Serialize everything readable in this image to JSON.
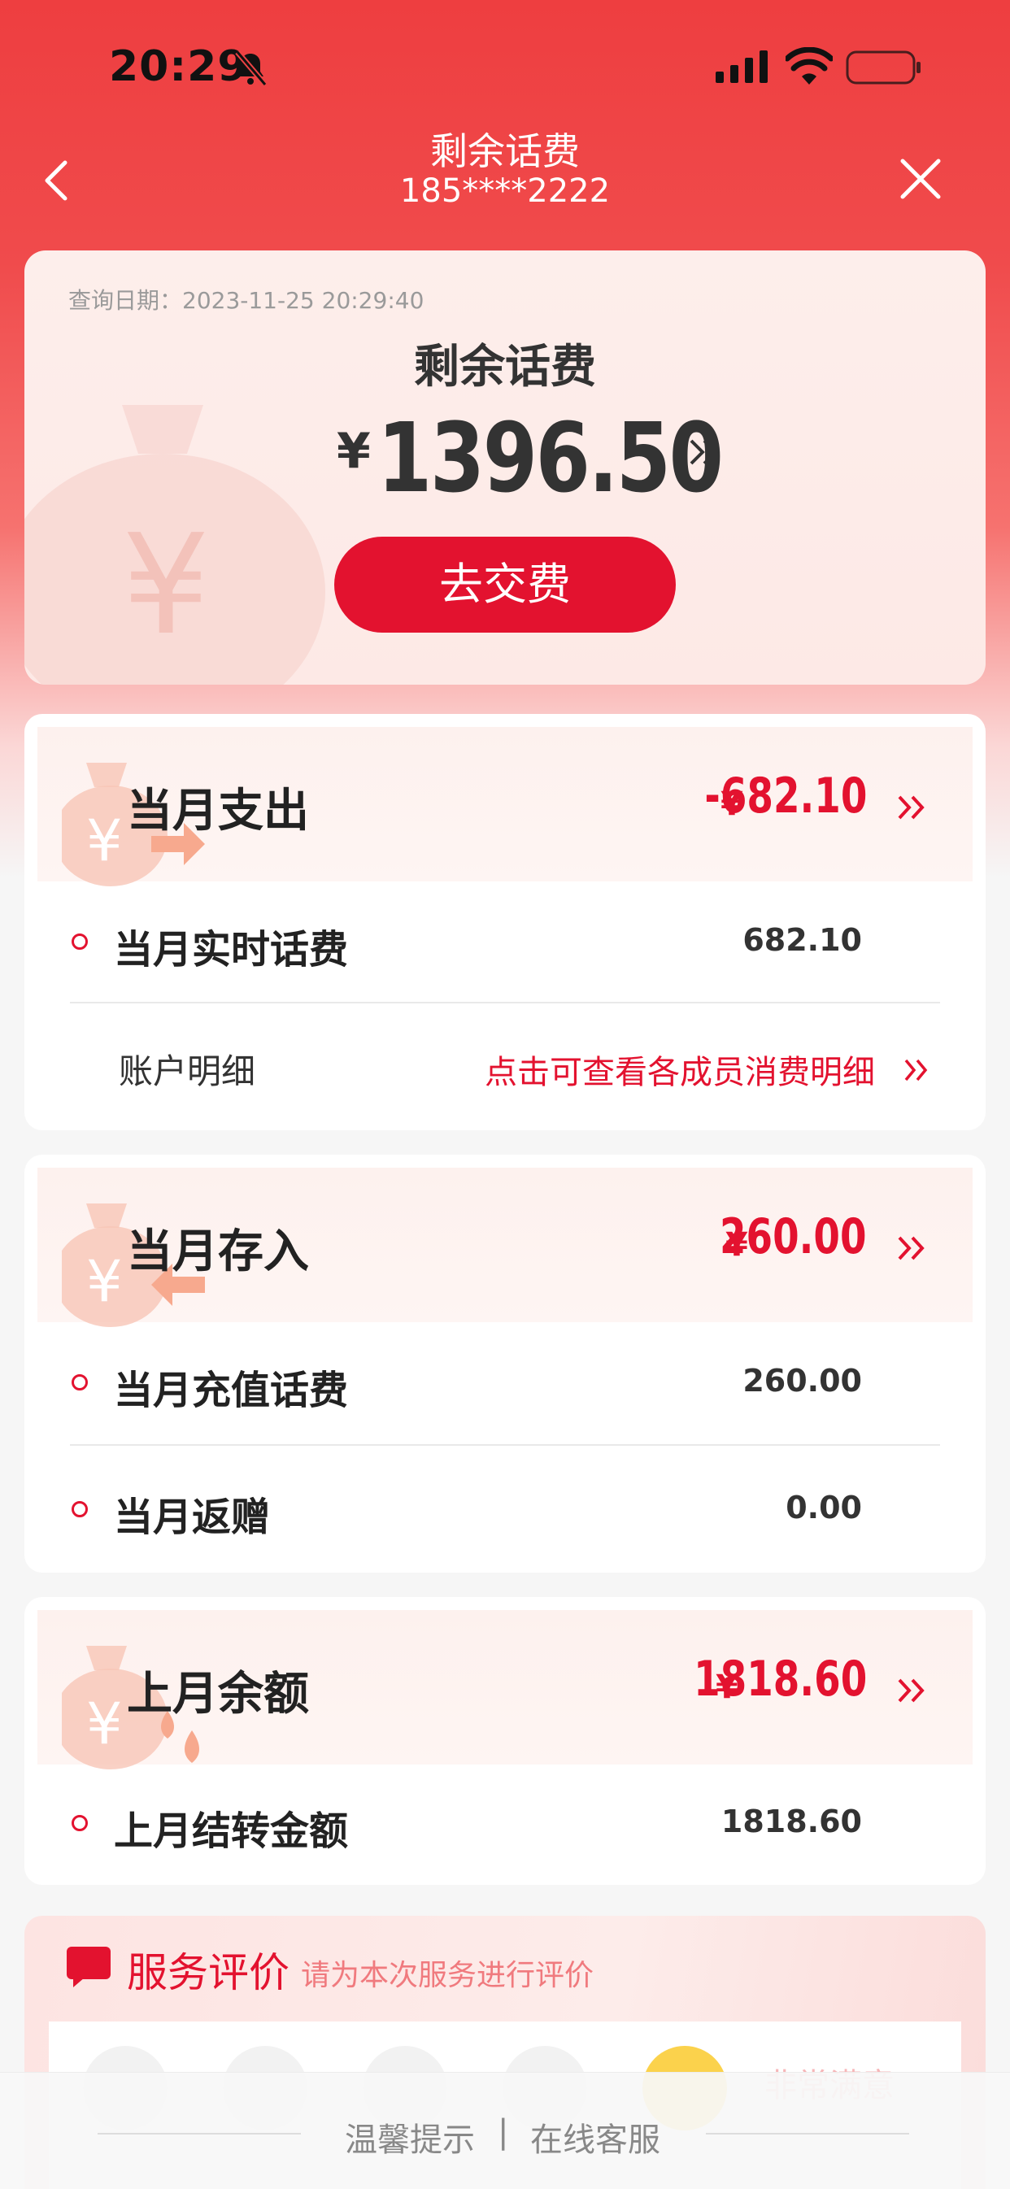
{
  "status_bar": {
    "time": "20:29"
  },
  "nav": {
    "title": "剩余话费",
    "phone": "185****2222"
  },
  "hero": {
    "query_date": "查询日期：2023-11-25 20:29:40",
    "balance_title": "剩余话费",
    "currency": "¥",
    "balance": "1396.50",
    "pay_button": "去交费"
  },
  "spending": {
    "title": "当月支出",
    "currency": "¥",
    "amount": "-682.10",
    "rows": [
      {
        "label": "当月实时话费",
        "value": "682.10"
      }
    ],
    "detail_label": "账户明细",
    "detail_link": "点击可查看各成员消费明细"
  },
  "deposit": {
    "title": "当月存入",
    "currency": "¥",
    "amount": "260.00",
    "rows": [
      {
        "label": "当月充值话费",
        "value": "260.00"
      },
      {
        "label": "当月返赠",
        "value": "0.00"
      }
    ]
  },
  "last_month": {
    "title": "上月余额",
    "currency": "¥",
    "amount": "1818.60",
    "rows": [
      {
        "label": "上月结转金额",
        "value": "1818.60"
      }
    ]
  },
  "rating": {
    "title": "服务评价",
    "subtitle": "请为本次服务进行评价",
    "selected_label": "非常满意"
  },
  "bottom_bar": {
    "tips": "温馨提示",
    "separator": "|",
    "service": "在线客服"
  },
  "colors": {
    "brand_red": "#e3122f",
    "header_red": "#ee3e40"
  }
}
